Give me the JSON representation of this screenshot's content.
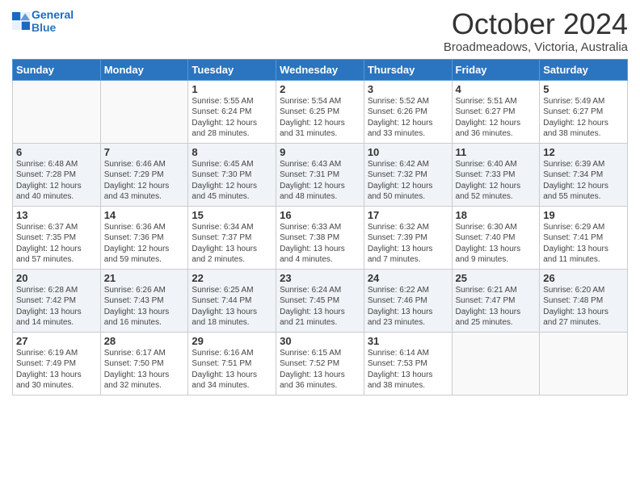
{
  "logo": {
    "line1": "General",
    "line2": "Blue"
  },
  "title": "October 2024",
  "subtitle": "Broadmeadows, Victoria, Australia",
  "days_of_week": [
    "Sunday",
    "Monday",
    "Tuesday",
    "Wednesday",
    "Thursday",
    "Friday",
    "Saturday"
  ],
  "weeks": [
    [
      {
        "day": "",
        "detail": ""
      },
      {
        "day": "",
        "detail": ""
      },
      {
        "day": "1",
        "detail": "Sunrise: 5:55 AM\nSunset: 6:24 PM\nDaylight: 12 hours and 28 minutes."
      },
      {
        "day": "2",
        "detail": "Sunrise: 5:54 AM\nSunset: 6:25 PM\nDaylight: 12 hours and 31 minutes."
      },
      {
        "day": "3",
        "detail": "Sunrise: 5:52 AM\nSunset: 6:26 PM\nDaylight: 12 hours and 33 minutes."
      },
      {
        "day": "4",
        "detail": "Sunrise: 5:51 AM\nSunset: 6:27 PM\nDaylight: 12 hours and 36 minutes."
      },
      {
        "day": "5",
        "detail": "Sunrise: 5:49 AM\nSunset: 6:27 PM\nDaylight: 12 hours and 38 minutes."
      }
    ],
    [
      {
        "day": "6",
        "detail": "Sunrise: 6:48 AM\nSunset: 7:28 PM\nDaylight: 12 hours and 40 minutes."
      },
      {
        "day": "7",
        "detail": "Sunrise: 6:46 AM\nSunset: 7:29 PM\nDaylight: 12 hours and 43 minutes."
      },
      {
        "day": "8",
        "detail": "Sunrise: 6:45 AM\nSunset: 7:30 PM\nDaylight: 12 hours and 45 minutes."
      },
      {
        "day": "9",
        "detail": "Sunrise: 6:43 AM\nSunset: 7:31 PM\nDaylight: 12 hours and 48 minutes."
      },
      {
        "day": "10",
        "detail": "Sunrise: 6:42 AM\nSunset: 7:32 PM\nDaylight: 12 hours and 50 minutes."
      },
      {
        "day": "11",
        "detail": "Sunrise: 6:40 AM\nSunset: 7:33 PM\nDaylight: 12 hours and 52 minutes."
      },
      {
        "day": "12",
        "detail": "Sunrise: 6:39 AM\nSunset: 7:34 PM\nDaylight: 12 hours and 55 minutes."
      }
    ],
    [
      {
        "day": "13",
        "detail": "Sunrise: 6:37 AM\nSunset: 7:35 PM\nDaylight: 12 hours and 57 minutes."
      },
      {
        "day": "14",
        "detail": "Sunrise: 6:36 AM\nSunset: 7:36 PM\nDaylight: 12 hours and 59 minutes."
      },
      {
        "day": "15",
        "detail": "Sunrise: 6:34 AM\nSunset: 7:37 PM\nDaylight: 13 hours and 2 minutes."
      },
      {
        "day": "16",
        "detail": "Sunrise: 6:33 AM\nSunset: 7:38 PM\nDaylight: 13 hours and 4 minutes."
      },
      {
        "day": "17",
        "detail": "Sunrise: 6:32 AM\nSunset: 7:39 PM\nDaylight: 13 hours and 7 minutes."
      },
      {
        "day": "18",
        "detail": "Sunrise: 6:30 AM\nSunset: 7:40 PM\nDaylight: 13 hours and 9 minutes."
      },
      {
        "day": "19",
        "detail": "Sunrise: 6:29 AM\nSunset: 7:41 PM\nDaylight: 13 hours and 11 minutes."
      }
    ],
    [
      {
        "day": "20",
        "detail": "Sunrise: 6:28 AM\nSunset: 7:42 PM\nDaylight: 13 hours and 14 minutes."
      },
      {
        "day": "21",
        "detail": "Sunrise: 6:26 AM\nSunset: 7:43 PM\nDaylight: 13 hours and 16 minutes."
      },
      {
        "day": "22",
        "detail": "Sunrise: 6:25 AM\nSunset: 7:44 PM\nDaylight: 13 hours and 18 minutes."
      },
      {
        "day": "23",
        "detail": "Sunrise: 6:24 AM\nSunset: 7:45 PM\nDaylight: 13 hours and 21 minutes."
      },
      {
        "day": "24",
        "detail": "Sunrise: 6:22 AM\nSunset: 7:46 PM\nDaylight: 13 hours and 23 minutes."
      },
      {
        "day": "25",
        "detail": "Sunrise: 6:21 AM\nSunset: 7:47 PM\nDaylight: 13 hours and 25 minutes."
      },
      {
        "day": "26",
        "detail": "Sunrise: 6:20 AM\nSunset: 7:48 PM\nDaylight: 13 hours and 27 minutes."
      }
    ],
    [
      {
        "day": "27",
        "detail": "Sunrise: 6:19 AM\nSunset: 7:49 PM\nDaylight: 13 hours and 30 minutes."
      },
      {
        "day": "28",
        "detail": "Sunrise: 6:17 AM\nSunset: 7:50 PM\nDaylight: 13 hours and 32 minutes."
      },
      {
        "day": "29",
        "detail": "Sunrise: 6:16 AM\nSunset: 7:51 PM\nDaylight: 13 hours and 34 minutes."
      },
      {
        "day": "30",
        "detail": "Sunrise: 6:15 AM\nSunset: 7:52 PM\nDaylight: 13 hours and 36 minutes."
      },
      {
        "day": "31",
        "detail": "Sunrise: 6:14 AM\nSunset: 7:53 PM\nDaylight: 13 hours and 38 minutes."
      },
      {
        "day": "",
        "detail": ""
      },
      {
        "day": "",
        "detail": ""
      }
    ]
  ]
}
